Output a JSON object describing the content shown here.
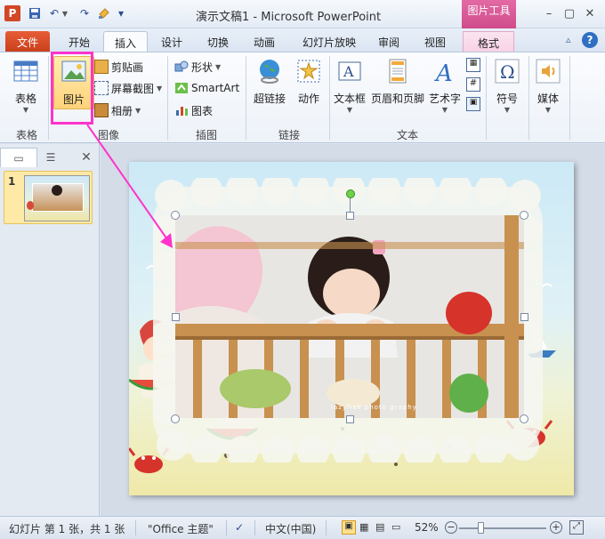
{
  "app": {
    "icon_letter": "P",
    "window_title": "演示文稿1  -  Microsoft PowerPoint",
    "context_header": "图片工具"
  },
  "window_controls": {
    "minimize": "–",
    "restore": "▢",
    "close": "✕"
  },
  "tabs": [
    {
      "id": "file",
      "label": "文件"
    },
    {
      "id": "home",
      "label": "开始"
    },
    {
      "id": "insert",
      "label": "插入"
    },
    {
      "id": "design",
      "label": "设计"
    },
    {
      "id": "transitions",
      "label": "切换"
    },
    {
      "id": "animations",
      "label": "动画"
    },
    {
      "id": "slideshow",
      "label": "幻灯片放映"
    },
    {
      "id": "review",
      "label": "审阅"
    },
    {
      "id": "view",
      "label": "视图"
    },
    {
      "id": "format",
      "label": "格式"
    }
  ],
  "ribbon": {
    "table": {
      "button": "表格",
      "group": "表格"
    },
    "images": {
      "picture": "图片",
      "clipart": "剪贴画",
      "screenshot": "屏幕截图",
      "album": "相册",
      "group": "图像"
    },
    "illustrations": {
      "shapes": "形状",
      "smartart": "SmartArt",
      "chart": "图表",
      "group": "插图"
    },
    "links": {
      "hyperlink": "超链接",
      "action": "动作",
      "group": "链接"
    },
    "text": {
      "textbox": "文本框",
      "header_footer": "页眉和页脚",
      "wordart": "艺术字",
      "group": "文本"
    },
    "symbols": {
      "symbol": "符号"
    },
    "media": {
      "media": "媒体"
    }
  },
  "left_panel": {
    "slide_number": "1"
  },
  "slide": {
    "photo_caption": "lazyfish  photo  graphy"
  },
  "status": {
    "slide_info": "幻灯片 第 1 张，共 1 张",
    "theme": "\"Office 主题\"",
    "language": "中文(中国)",
    "zoom": "52%",
    "zoom_fraction": 0.22
  },
  "colors": {
    "accent_file": "#d24726",
    "context_tab": "#cf4c8b",
    "highlight": "#ff33cc"
  }
}
